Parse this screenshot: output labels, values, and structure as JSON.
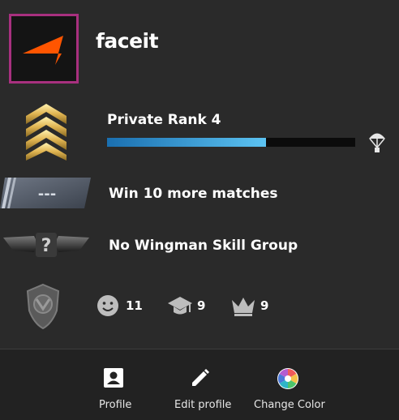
{
  "profile": {
    "username": "faceit",
    "avatar_border_color": "#a8307f",
    "avatar_logo_color": "#ff5500"
  },
  "rank": {
    "label": "Private Rank 4",
    "xp_progress": 0.64,
    "bar_color": "#4fb6ea",
    "icon": "chevron-rank-icon",
    "drop_icon": "parachute-icon"
  },
  "competitive": {
    "label": "Win 10 more matches",
    "icon": "skill-group-unranked-icon",
    "placeholder_text": "---"
  },
  "wingman": {
    "label": "No Wingman Skill Group",
    "icon": "wingman-unranked-icon"
  },
  "commendations": {
    "medal_icon": "service-medal-icon",
    "friendly": {
      "icon": "smiley-icon",
      "count": "11"
    },
    "teacher": {
      "icon": "graduation-cap-icon",
      "count": "9"
    },
    "leader": {
      "icon": "crown-icon",
      "count": "9"
    }
  },
  "bottom_bar": {
    "profile_label": "Profile",
    "edit_label": "Edit profile",
    "color_label": "Change Color"
  }
}
